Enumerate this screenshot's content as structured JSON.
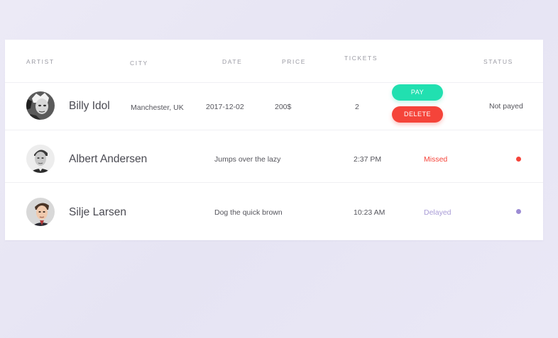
{
  "table": {
    "headers": {
      "artist": "ARTIST",
      "city": "CITY",
      "date": "DATE",
      "price": "PRICE",
      "tickets": "TICKETS",
      "status": "STATUS"
    },
    "rows": [
      {
        "name": "Billy Idol",
        "city": "Manchester, UK",
        "date": "2017-12-02",
        "price": "200$",
        "tickets": "2",
        "pay_label": "PAY",
        "delete_label": "DELETE",
        "status": "Not payed"
      },
      {
        "name": "Albert Andersen",
        "description": "Jumps over the lazy",
        "time": "2:37 PM",
        "state": "Missed",
        "state_color": "#f5443a",
        "dot_color": "#f5443a"
      },
      {
        "name": "Silje Larsen",
        "description": "Dog the quick brown",
        "time": "10:23 AM",
        "state": "Delayed",
        "state_color": "#a89bd6",
        "dot_color": "#9c8cd4"
      }
    ]
  },
  "colors": {
    "pay": "#21e0b0",
    "delete": "#f5443a",
    "background": "#eceaf6"
  }
}
